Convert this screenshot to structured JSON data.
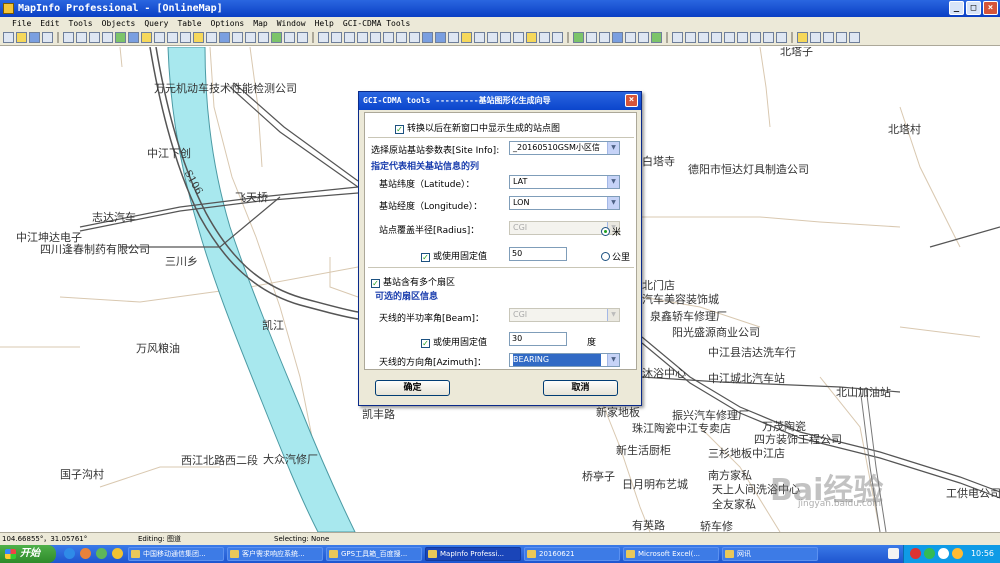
{
  "window": {
    "title": "MapInfo Professional - [OnlineMap]",
    "controls": {
      "minimize": "_",
      "maximize": "□",
      "close": "×"
    }
  },
  "menu": [
    "File",
    "Edit",
    "Tools",
    "Objects",
    "Query",
    "Table",
    "Options",
    "Map",
    "Window",
    "Help",
    "GCI-CDMA Tools"
  ],
  "map": {
    "labels": [
      "万元机动车技术性能检测公司",
      "中江下创",
      "志达汽车",
      "中江坤达电子",
      "四川逢春制药有限公司",
      "三川乡",
      "飞天桥",
      "凯江",
      "万风粮油",
      "凯丰路",
      "大众汽修厂",
      "西江北路西二段",
      "国子沟村",
      "北塔子",
      "北塔村",
      "白塔寺",
      "德阳市恒达灯具制造公司",
      "北门店",
      "汽车美容装饰城",
      "泉鑫轿车修理厂",
      "阳光盛源商业公司",
      "中江县洁达洗车行",
      "中江城北汽车站",
      "沐浴中心",
      "北山加油站",
      "新家地板",
      "振兴汽车修理厂",
      "珠江陶瓷中江专卖店",
      "万茂陶瓷",
      "四方装饰工程公司",
      "新生活厨柜",
      "三杉地板中江店",
      "桥亭子",
      "日月明布艺城",
      "南方家私",
      "天上人间洗浴中心",
      "全友家私",
      "有英路",
      "轿车修",
      "工供电公司",
      "S106"
    ]
  },
  "dialog": {
    "title": "GCI-CDMA tools ---------基站图形化生成向导",
    "close": "×",
    "show_in_new_window": "转换以后在新窗口中显示生成的站点图",
    "site_info_label": "选择原站基站参数表[Site Info]:",
    "site_info_value": "_20160510GSM小区信",
    "section_columns": "指定代表相关基站信息的列",
    "latitude_label": "基站纬度（Latitude）：",
    "latitude_value": "LAT",
    "longitude_label": "基站经度（Longitude）：",
    "longitude_value": "LON",
    "radius_label": "站点覆盖半径[Radius]：",
    "radius_value": "CGI",
    "unit_m": "米",
    "use_fixed_label": "或使用固定值",
    "fixed_radius_value": "50",
    "unit_km": "公里",
    "multi_sector_label": "基站含有多个扇区",
    "section_sector": "可选的扇区信息",
    "beam_label": "天线的半功率角[Beam]：",
    "beam_value": "CGI",
    "fixed_beam_label": "或使用固定值",
    "fixed_beam_value": "30",
    "unit_deg": "度",
    "azimuth_label": "天线的方向角[Azimuth]：",
    "azimuth_value": "BEARING",
    "ok": "确定",
    "cancel": "取消"
  },
  "status": {
    "coords": "104.66855°，31.05761°",
    "editing": "Editing: 图道",
    "selecting": "Selecting: None"
  },
  "taskbar": {
    "start": "开始",
    "tasks": [
      "中国移动通信集团...",
      "客户需求响应系统...",
      "GPS工具箱_百度搜...",
      "MapInfo Professi...",
      "20160621",
      "Microsoft Excel(...",
      "网讯"
    ],
    "clock": "10:56"
  },
  "watermark": {
    "text": "Bai经验",
    "url": "jingyan.baidu.com"
  },
  "colors": {
    "river": "#a8e8ee",
    "titlebar": "#0a3fc4",
    "dialog_bg": "#ece9d8",
    "section": "#1c3fae"
  }
}
